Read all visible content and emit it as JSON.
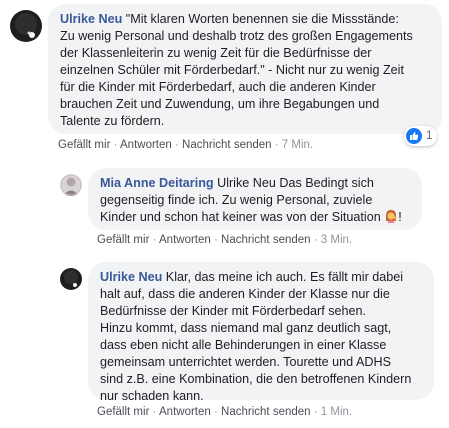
{
  "comments": [
    {
      "author": "Ulrike Neu",
      "lines": [
        "\"Mit klaren Worten benennen sie die Missstände:",
        "Zu wenig Personal und deshalb trotz des großen Engagements",
        "der Klassenleiterin zu wenig Zeit für die Bedürfnisse der",
        "einzelnen Schüler mit Förderbedarf.\" - Nicht nur zu wenig Zeit",
        "für die Kinder mit Förderbedarf, auch die anderen Kinder",
        "brauchen Zeit und Zuwendung, um ihre Begabungen und",
        "Talente zu fördern."
      ],
      "reaction": {
        "icon": "thumbs-up-icon",
        "count": "1"
      },
      "actions": {
        "like": "Gefällt mir",
        "reply": "Antworten",
        "message": "Nachricht senden",
        "time": "7 Min."
      }
    },
    {
      "author": "Mia Anne Deitaring",
      "lines": [
        "Ulrike Neu Das Bedingt sich",
        "gegenseitig finde ich. Zu wenig Personal, zuviele",
        "Kinder und schon hat keiner was von der Situation",
        "!"
      ],
      "emoji": "woman-tipping-hand-emoji",
      "actions": {
        "like": "Gefällt mir",
        "reply": "Antworten",
        "message": "Nachricht senden",
        "time": "3 Min."
      }
    },
    {
      "author": "Ulrike Neu",
      "lines": [
        "Klar, das meine ich auch. Es fällt mir dabei",
        "halt auf, dass die anderen Kinder der Klasse nur die",
        "Bedürfnisse der Kinder mit Förderbedarf sehen.",
        "Hinzu kommt, dass niemand mal ganz deutlich sagt,",
        "dass eben nicht alle Behinderungen in einer Klasse",
        "gemeinsam unterrichtet werden. Tourette und ADHS",
        "sind z.B. eine Kombination, die den betroffenen Kindern",
        "nur schaden kann."
      ],
      "actions": {
        "like": "Gefällt mir",
        "reply": "Antworten",
        "message": "Nachricht senden",
        "time": "1 Min."
      }
    }
  ],
  "separator": "·",
  "colors": {
    "author": "#385898",
    "bubble": "#f2f3f5",
    "like": "#1877f2"
  }
}
